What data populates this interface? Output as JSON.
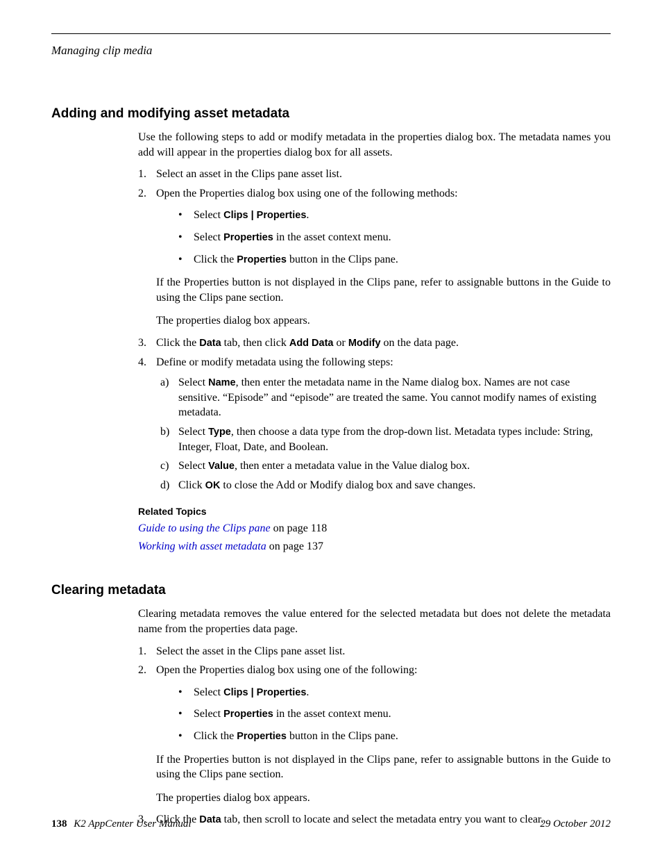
{
  "runningHead": "Managing clip media",
  "section1": {
    "title": "Adding and modifying asset metadata",
    "intro": "Use the following steps to add or modify metadata in the properties dialog box. The metadata names you add will appear in the properties dialog box for all assets.",
    "step1": "Select an asset in the Clips pane asset list.",
    "step2": "Open the Properties dialog box using one of the following methods:",
    "bullets": {
      "b1_pre": "Select ",
      "b1_bold": "Clips | Properties",
      "b1_post": ".",
      "b2_pre": "Select ",
      "b2_bold": "Properties",
      "b2_post": " in the asset context menu.",
      "b3_pre": "Click the ",
      "b3_bold": "Properties",
      "b3_post": " button in the Clips pane."
    },
    "note1": "If the Properties button is not displayed in the Clips pane, refer to assignable buttons in the Guide to using the Clips pane section.",
    "note2": "The properties dialog box appears.",
    "step3_pre": "Click the ",
    "step3_b1": "Data",
    "step3_mid1": " tab, then click ",
    "step3_b2": "Add Data",
    "step3_mid2": " or ",
    "step3_b3": "Modify",
    "step3_post": " on the data page.",
    "step4": "Define or modify metadata using the following steps:",
    "letters": {
      "a_pre": "Select ",
      "a_bold": "Name",
      "a_post": ", then enter the metadata name in the Name dialog box. Names are not case sensitive. “Episode” and “episode” are treated the same. You cannot modify names of existing metadata.",
      "b_pre": "Select ",
      "b_bold": "Type",
      "b_post": ", then choose a data type from the drop-down list. Metadata types include: String, Integer, Float, Date, and Boolean.",
      "c_pre": "Select ",
      "c_bold": "Value",
      "c_post": ", then enter a metadata value in the Value dialog box.",
      "d_pre": "Click ",
      "d_bold": "OK",
      "d_post": " to close the Add or Modify dialog box and save changes."
    },
    "relatedHeading": "Related Topics",
    "related1_link": "Guide to using the Clips pane",
    "related1_tail": " on page 118",
    "related2_link": "Working with asset metadata",
    "related2_tail": " on page 137"
  },
  "section2": {
    "title": "Clearing metadata",
    "intro": "Clearing metadata removes the value entered for the selected metadata but does not delete the metadata name from the properties data page.",
    "step1": "Select the asset in the Clips pane asset list.",
    "step2": "Open the Properties dialog box using one of the following:",
    "bullets": {
      "b1_pre": "Select ",
      "b1_bold": "Clips | Properties",
      "b1_post": ".",
      "b2_pre": "Select ",
      "b2_bold": "Properties",
      "b2_post": " in the asset context menu.",
      "b3_pre": "Click the ",
      "b3_bold": "Properties",
      "b3_post": " button in the Clips pane."
    },
    "note1": "If the Properties button is not displayed in the Clips pane, refer to assignable buttons in the Guide to using the Clips pane section.",
    "note2": "The properties dialog box appears.",
    "step3_pre": "Click the ",
    "step3_b1": "Data",
    "step3_post": " tab, then scroll to locate and select the metadata entry you want to clear."
  },
  "footer": {
    "page": "138",
    "doc": "K2 AppCenter User Manual",
    "date": "29 October 2012"
  }
}
